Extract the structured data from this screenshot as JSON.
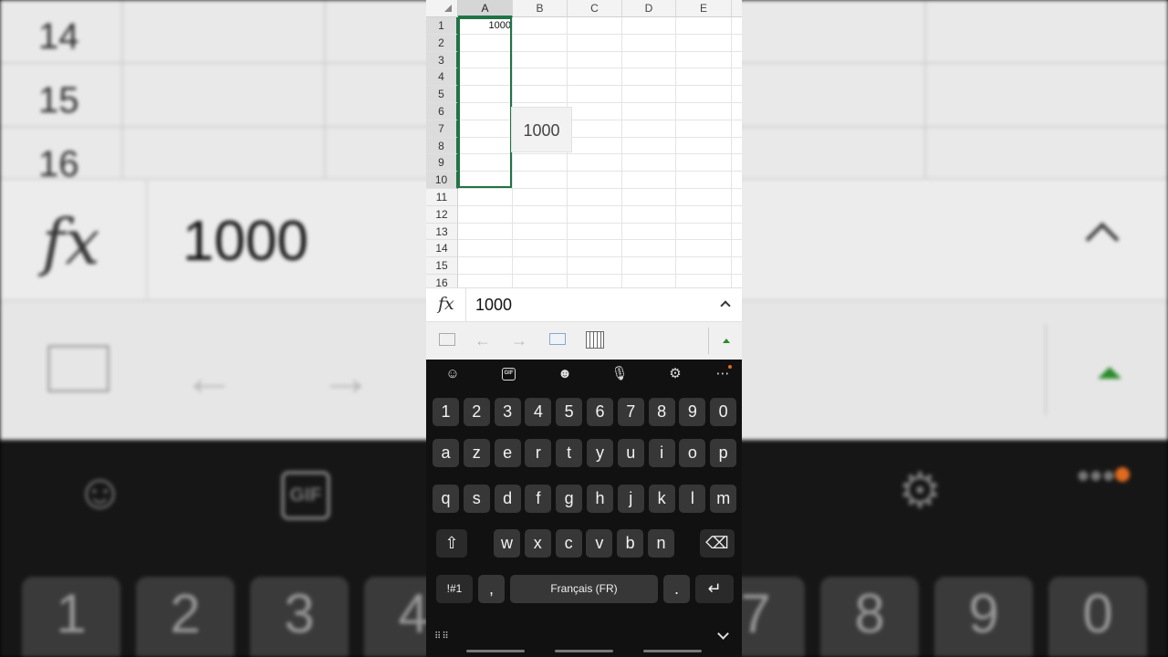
{
  "app": {
    "accent_color": "#217346",
    "notification_dot_color": "#e06a20"
  },
  "spreadsheet": {
    "columns": [
      "A",
      "B",
      "C",
      "D",
      "E"
    ],
    "rows": [
      "1",
      "2",
      "3",
      "4",
      "5",
      "6",
      "7",
      "8",
      "9",
      "10",
      "11",
      "12",
      "13",
      "14",
      "15",
      "16"
    ],
    "cell_A1": "1000",
    "selected_range": "A1:A10",
    "fill_preview": "1000"
  },
  "formula_bar": {
    "fx_label": "fx",
    "value": "1000"
  },
  "toolbar": {
    "icons": [
      "screen-icon",
      "undo-arrow-icon",
      "redo-arrow-icon",
      "keyboard-icon",
      "calendar-icon",
      "expand-triangle-icon"
    ]
  },
  "keyboard": {
    "top_icons": [
      "emoji-icon",
      "gif-icon",
      "sticker-icon",
      "microphone-icon",
      "settings-icon",
      "more-icon"
    ],
    "gif_label": "GIF",
    "number_row": [
      "1",
      "2",
      "3",
      "4",
      "5",
      "6",
      "7",
      "8",
      "9",
      "0"
    ],
    "row1": [
      "a",
      "z",
      "e",
      "r",
      "t",
      "y",
      "u",
      "i",
      "o",
      "p"
    ],
    "row2": [
      "q",
      "s",
      "d",
      "f",
      "g",
      "h",
      "j",
      "k",
      "l",
      "m"
    ],
    "row3": [
      "w",
      "x",
      "c",
      "v",
      "b",
      "n"
    ],
    "symbols_label": "!#1",
    "comma": ",",
    "space_label": "Français (FR)",
    "period": "."
  },
  "background_zoom": {
    "rows": [
      "14",
      "15",
      "16"
    ],
    "fx_label": "fx",
    "value": "1000",
    "gif_label": "GIF",
    "keys": [
      "1",
      "2",
      "3",
      "4",
      "7",
      "8",
      "9",
      "0"
    ]
  }
}
